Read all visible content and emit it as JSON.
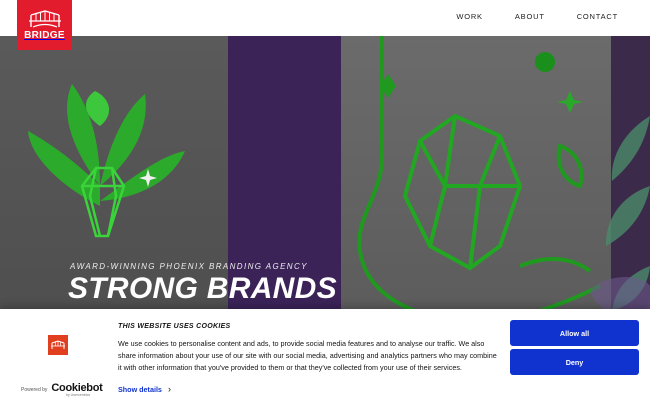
{
  "header": {
    "logo_text": "BRIDGE",
    "nav": [
      {
        "label": "WORK"
      },
      {
        "label": "ABOUT"
      },
      {
        "label": "CONTACT"
      }
    ]
  },
  "hero": {
    "tagline": "AWARD-WINNING PHOENIX BRANDING AGENCY",
    "headline": "STRONG BRANDS",
    "colors": {
      "stripe": "#3b2358",
      "art_green": "#2fbf2f"
    }
  },
  "cookie_banner": {
    "title": "THIS WEBSITE USES COOKIES",
    "text": "We use cookies to personalise content and ads, to provide social media features and to analyse our traffic. We also share information about your use of our site with our social media, advertising and analytics partners who may combine it with other information that you've provided to them or that they've collected from your use of their services.",
    "show_details": "Show details",
    "allow_all": "Allow all",
    "deny": "Deny",
    "powered_by": "Powered by",
    "brand": "Cookiebot",
    "brand_sub": "by Usercentrics",
    "accent_color": "#1032cf"
  }
}
